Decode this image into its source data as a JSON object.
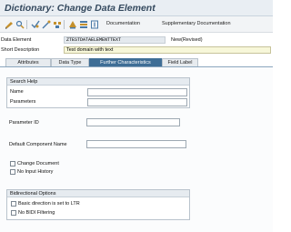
{
  "window": {
    "title": "Dictionary: Change Data Element"
  },
  "toolbar": {
    "icons": [
      "other-object-icon",
      "display-change-icon",
      "check-icon",
      "activate-icon",
      "where-used-icon",
      "object-list-icon",
      "hierarchy-icon",
      "info-icon"
    ],
    "documentation_label": "Documentation",
    "supplementary_label": "Supplementary Documentation"
  },
  "header": {
    "data_element_label": "Data Element",
    "data_element_value": "ZTESTDATAELEMENTTEXT",
    "status": "New(Revised)",
    "short_description_label": "Short Description",
    "short_description_value": "Test domain with text"
  },
  "tabs": [
    {
      "label": "Attributes",
      "active": false
    },
    {
      "label": "Data Type",
      "active": false
    },
    {
      "label": "Further Characteristics",
      "active": true
    },
    {
      "label": "Field Label",
      "active": false
    }
  ],
  "search_help": {
    "title": "Search Help",
    "name_label": "Name",
    "name_value": "",
    "parameters_label": "Parameters",
    "parameters_value": ""
  },
  "parameter_id": {
    "label": "Parameter ID",
    "value": ""
  },
  "default_component": {
    "label": "Default Component Name",
    "value": ""
  },
  "checkboxes": {
    "change_document": {
      "label": "Change Document",
      "checked": false
    },
    "no_input_history": {
      "label": "No Input History",
      "checked": false
    }
  },
  "bidi": {
    "title": "Bidirectional Options",
    "ltr": {
      "label": "Basic direction is set to LTR",
      "checked": false
    },
    "no_filtering": {
      "label": "No BIDI Filtering",
      "checked": false
    }
  },
  "colors": {
    "accent": "#3f6e96",
    "title": "#34495e",
    "short_desc_bg": "#f7f7d9"
  }
}
